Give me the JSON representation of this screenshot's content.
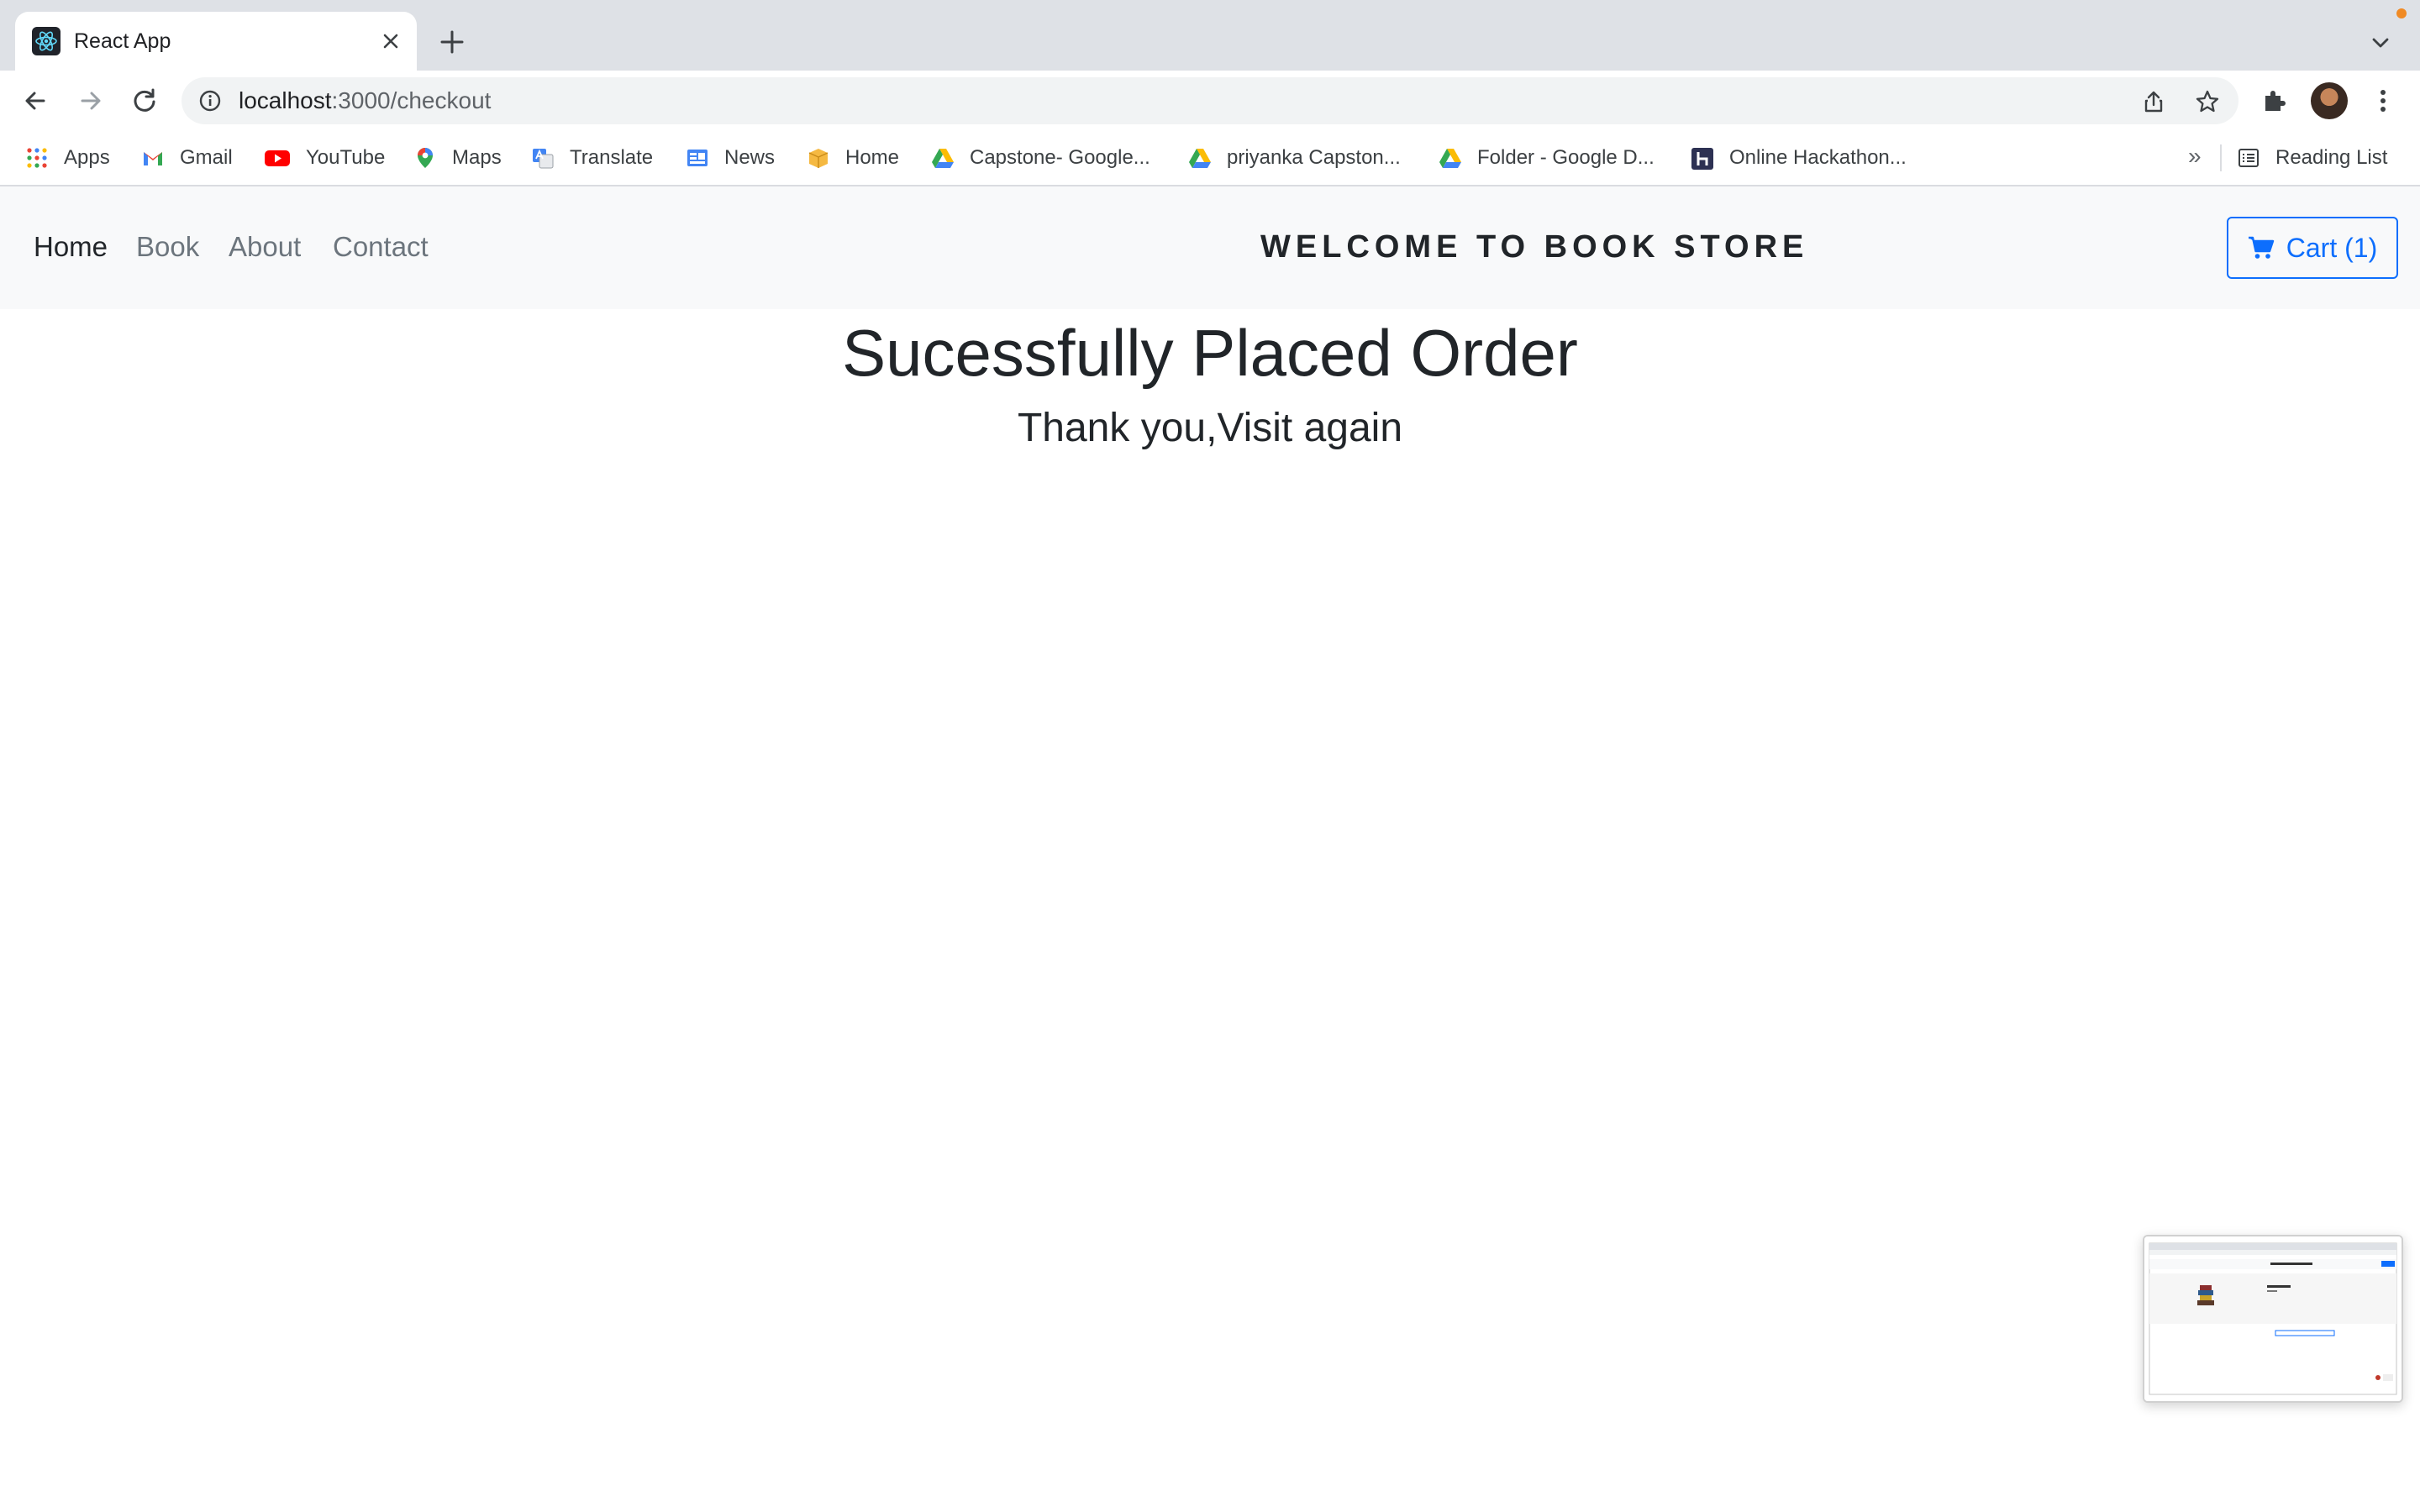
{
  "browser": {
    "tab": {
      "title": "React App"
    },
    "url": {
      "host": "localhost",
      "path": ":3000/checkout"
    },
    "bookmarks": [
      {
        "label": "Apps",
        "icon": "apps-grid-icon"
      },
      {
        "label": "Gmail",
        "icon": "gmail-icon"
      },
      {
        "label": "YouTube",
        "icon": "youtube-icon"
      },
      {
        "label": "Maps",
        "icon": "maps-pin-icon"
      },
      {
        "label": "Translate",
        "icon": "translate-icon"
      },
      {
        "label": "News",
        "icon": "news-icon"
      },
      {
        "label": "Home",
        "icon": "box-icon"
      },
      {
        "label": "Capstone- Google...",
        "icon": "drive-icon"
      },
      {
        "label": "priyanka Capston...",
        "icon": "drive-icon"
      },
      {
        "label": "Folder - Google D...",
        "icon": "drive-icon"
      },
      {
        "label": "Online Hackathon...",
        "icon": "hackathon-h-icon"
      }
    ],
    "bookmarks_overflow": "»",
    "reading_list": "Reading List"
  },
  "navbar": {
    "links": [
      "Home",
      "Book",
      "About",
      "Contact"
    ],
    "active": "Home",
    "brand": "WELCOME TO BOOK STORE",
    "cart_label": "Cart (1)"
  },
  "main": {
    "heading": "Sucessfully Placed Order",
    "subheading": "Thank you,Visit again"
  },
  "colors": {
    "accent": "#0d6efd",
    "navbar_bg": "#f8f9fa",
    "text": "#212529",
    "muted_link": "#6c757d"
  }
}
